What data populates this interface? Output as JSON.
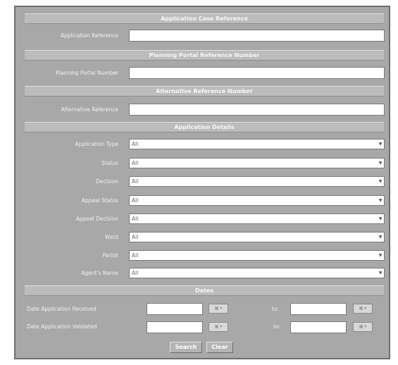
{
  "sections": {
    "case_reference": "Application Case Reference",
    "planning_portal": "Planning Portal Reference Number",
    "alternative": "Alternative Reference Number",
    "details": "Application Details",
    "dates": "Dates"
  },
  "fields": {
    "application_reference": {
      "label": "Application Reference",
      "value": ""
    },
    "planning_portal_number": {
      "label": "Planning Portal Number",
      "value": ""
    },
    "alternative_reference": {
      "label": "Alternative Reference",
      "value": ""
    }
  },
  "selects": [
    {
      "label": "Application Type",
      "value": "All"
    },
    {
      "label": "Status",
      "value": "All"
    },
    {
      "label": "Decision",
      "value": "All"
    },
    {
      "label": "Appeal Status",
      "value": "All"
    },
    {
      "label": "Appeal Decision",
      "value": "All"
    },
    {
      "label": "Ward",
      "value": "All"
    },
    {
      "label": "Parish",
      "value": "All"
    },
    {
      "label": "Agent's Name",
      "value": "All"
    }
  ],
  "dates": {
    "received_label": "Date Application Received",
    "validated_label": "Date Application Validated",
    "to_label": "to:",
    "calendar_icon": "calendar-icon"
  },
  "buttons": {
    "search": "Search",
    "clear": "Clear"
  }
}
